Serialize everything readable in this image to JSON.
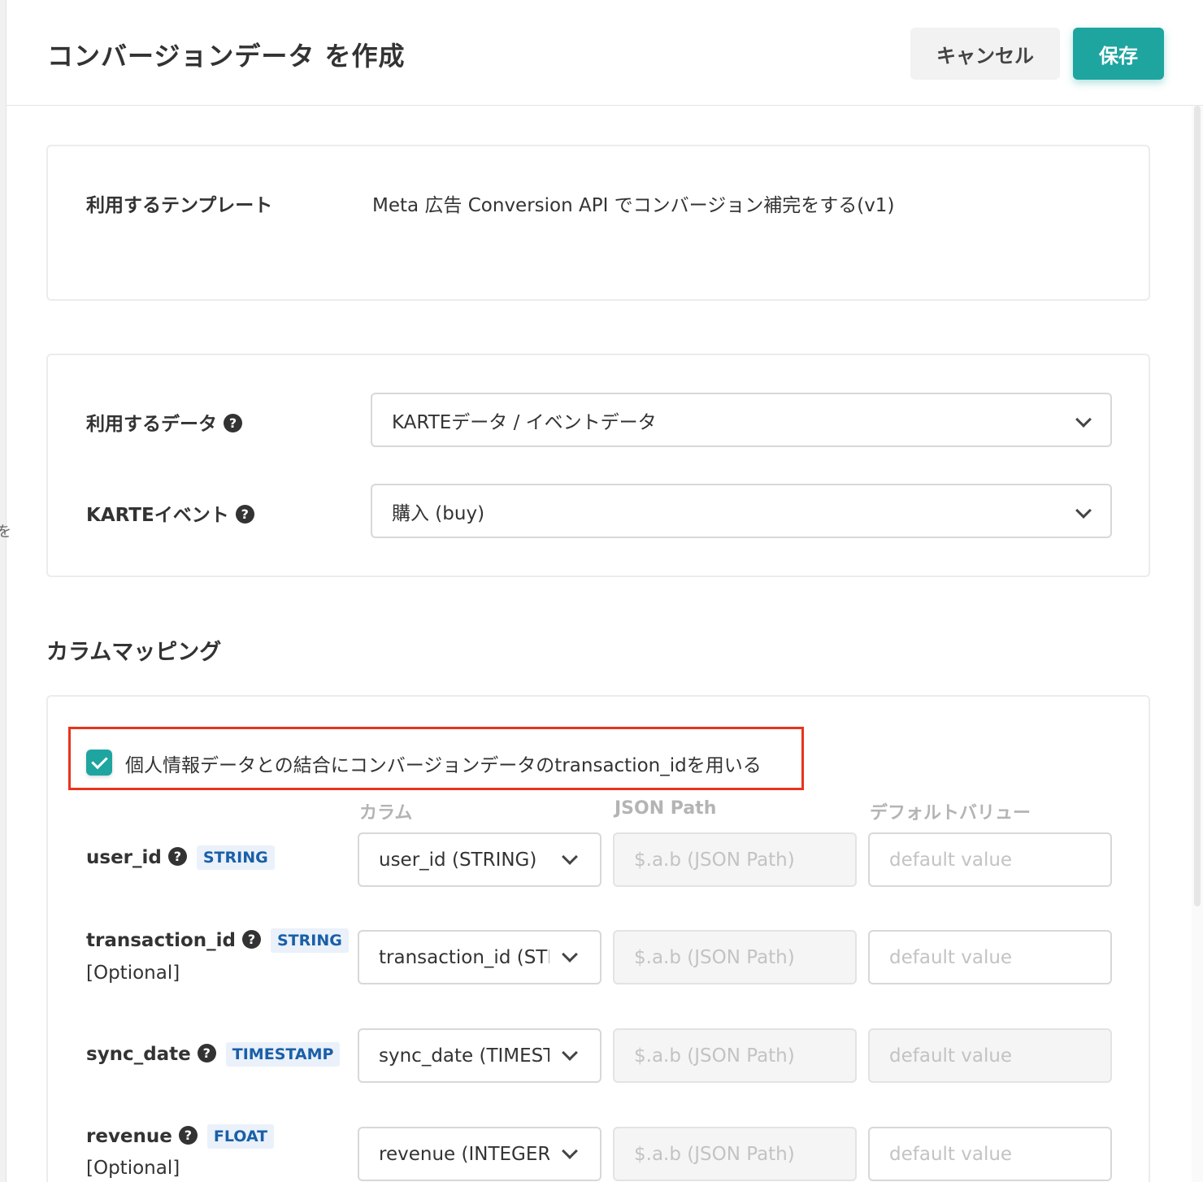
{
  "page": {
    "title": "コンバージョンデータ を作成",
    "left_glyph": "を"
  },
  "header": {
    "cancel_label": "キャンセル",
    "save_label": "保存"
  },
  "template_section": {
    "label": "利用するテンプレート",
    "value": "Meta 広告 Conversion API でコンバージョン補完をする(v1)"
  },
  "data_section": {
    "data_label": "利用するデータ",
    "data_value": "KARTEデータ / イベントデータ",
    "event_label": "KARTEイベント",
    "event_value": "購入 (buy)",
    "help_glyph": "?"
  },
  "mapping": {
    "title": "カラムマッピング",
    "checkbox_checked": true,
    "checkbox_label": "個人情報データとの結合にコンバージョンデータのtransaction_idを用いる",
    "columns": {
      "column": "カラム",
      "json_path": "JSON Path",
      "default_value": "デフォルトバリュー"
    },
    "rows": [
      {
        "name": "user_id",
        "type": "STRING",
        "optional": "",
        "column_value": "user_id (STRING)",
        "json_placeholder": "$.a.b (JSON Path)",
        "default_placeholder": "default value"
      },
      {
        "name": "transaction_id",
        "type": "STRING",
        "optional": "[Optional]",
        "column_value": "transaction_id (STRING)",
        "json_placeholder": "$.a.b (JSON Path)",
        "default_placeholder": "default value"
      },
      {
        "name": "sync_date",
        "type": "TIMESTAMP",
        "optional": "",
        "column_value": "sync_date (TIMESTAMP)",
        "json_placeholder": "$.a.b (JSON Path)",
        "default_placeholder": "default value"
      },
      {
        "name": "revenue",
        "type": "FLOAT",
        "optional": "[Optional]",
        "column_value": "revenue (INTEGER)",
        "json_placeholder": "$.a.b (JSON Path)",
        "default_placeholder": "default value"
      }
    ]
  },
  "colors": {
    "accent": "#1ea5a0",
    "highlight_border": "#e8341c",
    "badge_text": "#1a5fa8"
  }
}
